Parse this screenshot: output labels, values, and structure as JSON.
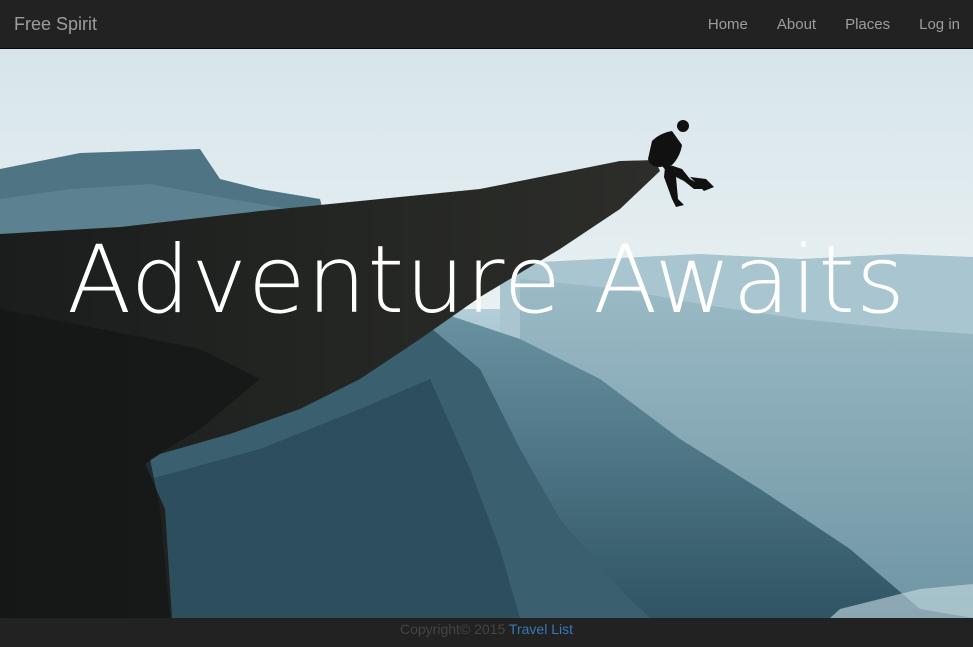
{
  "navbar": {
    "brand": "Free Spirit",
    "links": [
      {
        "label": "Home"
      },
      {
        "label": "About"
      },
      {
        "label": "Places"
      },
      {
        "label": "Log in"
      }
    ]
  },
  "hero": {
    "title": "Adventure Awaits"
  },
  "footer": {
    "copyright": "Copyright© 2015",
    "link_label": "Travel List"
  },
  "colors": {
    "navbar_bg": "#222222",
    "nav_text": "#9d9d9d",
    "link_blue": "#337ab7"
  }
}
